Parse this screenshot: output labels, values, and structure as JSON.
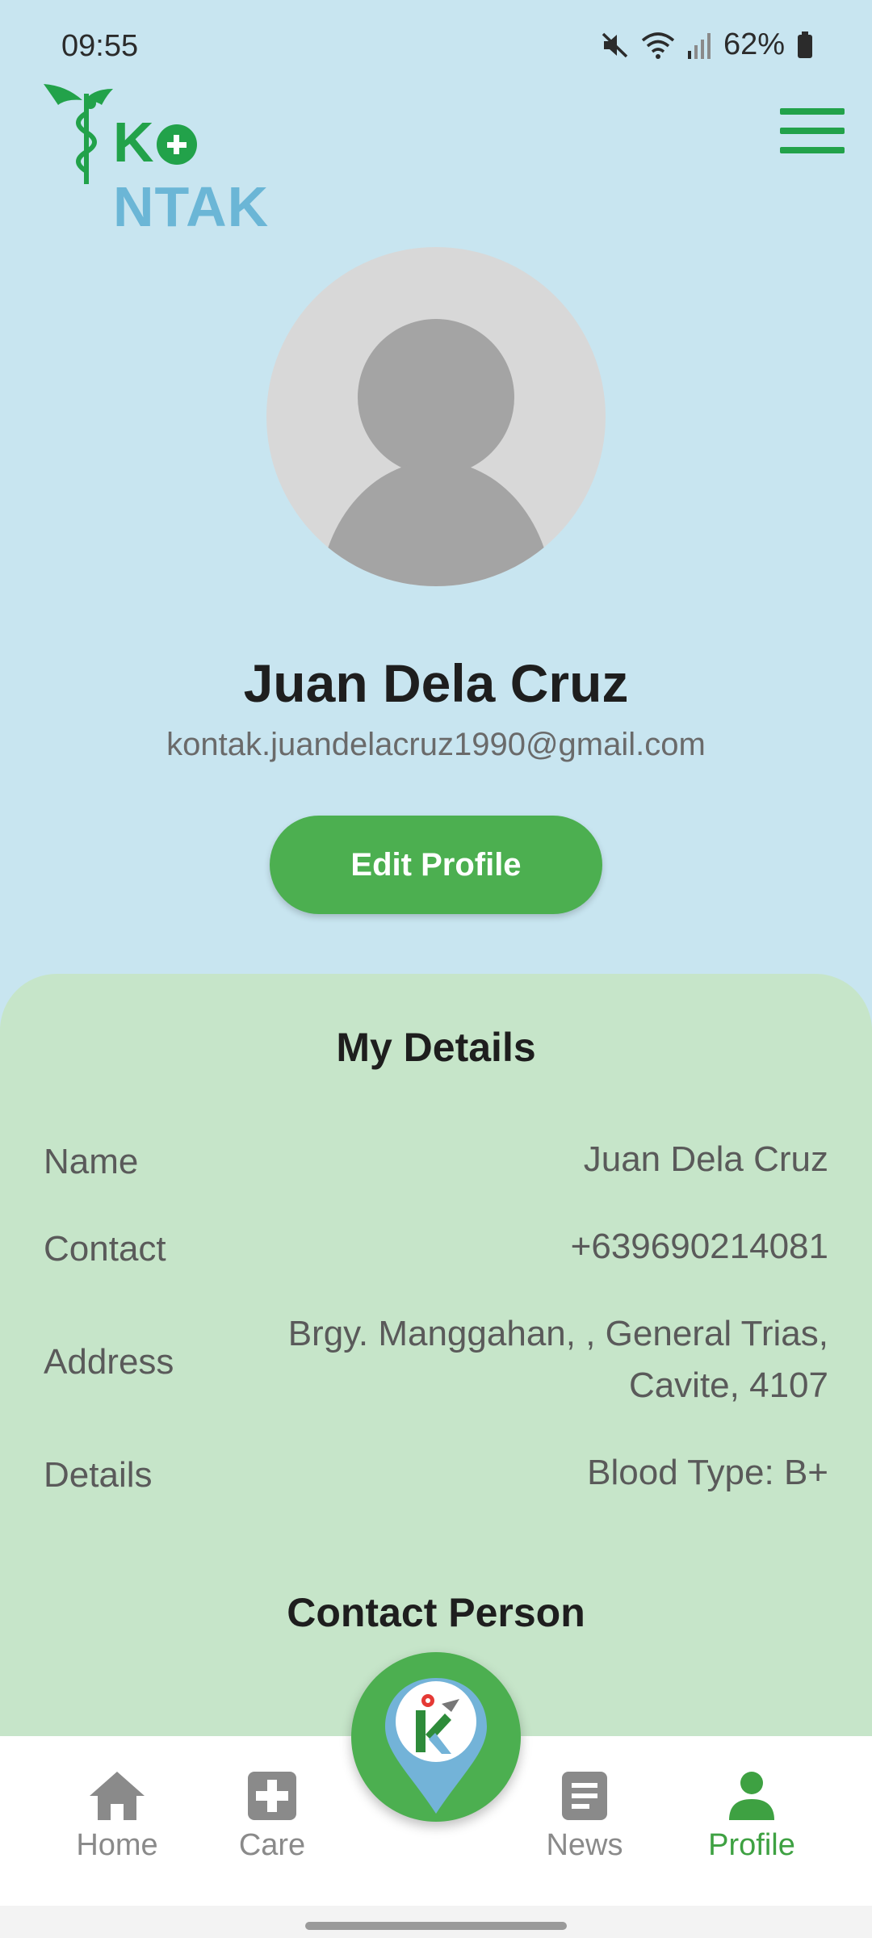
{
  "status_bar": {
    "time": "09:55",
    "battery": "62%",
    "icons": [
      "mute-icon",
      "wifi-icon",
      "signal-icon",
      "battery-icon"
    ]
  },
  "header": {
    "logo_text_k": "K",
    "logo_text_rest": "NTAK",
    "logo_colors": {
      "green": "#22a24a",
      "blue": "#6bb6d6"
    },
    "menu_icon": "hamburger-menu-icon"
  },
  "profile": {
    "name": "Juan Dela Cruz",
    "email": "kontak.juandelacruz1990@gmail.com",
    "edit_button": "Edit Profile"
  },
  "my_details": {
    "title": "My Details",
    "rows": [
      {
        "label": "Name",
        "value": "Juan Dela Cruz"
      },
      {
        "label": "Contact",
        "value": "+639690214081"
      },
      {
        "label": "Address",
        "value_line1": "Brgy. Manggahan, , General Trias,",
        "value_line2": "Cavite, 4107"
      },
      {
        "label": "Details",
        "value": "Blood Type: B+"
      }
    ]
  },
  "contact_person": {
    "title": "Contact Person"
  },
  "bottom_nav": {
    "items": [
      {
        "label": "Home",
        "icon": "home-icon",
        "active": false
      },
      {
        "label": "Care",
        "icon": "medical-cross-icon",
        "active": false
      },
      {
        "label": "News",
        "icon": "news-icon",
        "active": false
      },
      {
        "label": "Profile",
        "icon": "person-icon",
        "active": true
      }
    ],
    "fab_icon": "kontak-location-pin-icon"
  },
  "colors": {
    "background": "#c8e5f0",
    "panel": "#c6e5c9",
    "accent": "#4caf50",
    "nav_active": "#3ea142",
    "nav_inactive": "#8a8a8a"
  }
}
